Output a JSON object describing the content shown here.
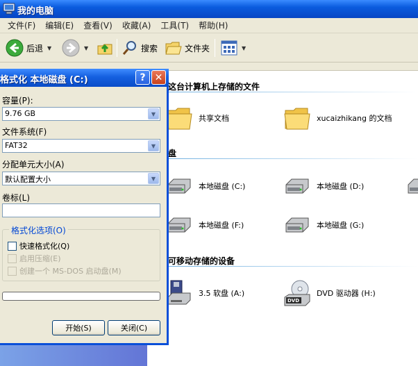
{
  "window": {
    "title": "我的电脑"
  },
  "menu": [
    "文件(F)",
    "编辑(E)",
    "查看(V)",
    "收藏(A)",
    "工具(T)",
    "帮助(H)"
  ],
  "toolbar": {
    "back": "后退",
    "search": "搜索",
    "folders": "文件夹"
  },
  "content": {
    "group1": "这台计算机上存储的文件",
    "shared_docs": "共享文档",
    "user_docs": "xucaizhikang 的文档",
    "group2": "盘",
    "drive_c": "本地磁盘 (C:)",
    "drive_d": "本地磁盘 (D:)",
    "drive_f": "本地磁盘 (F:)",
    "drive_g": "本地磁盘 (G:)",
    "group3": "可移动存储的设备",
    "floppy": "3.5 软盘 (A:)",
    "dvd": "DVD 驱动器 (H:)"
  },
  "dialog": {
    "title": "格式化 本地磁盘 (C:)",
    "capacity_label": "容量(P):",
    "capacity_value": "9.76 GB",
    "fs_label": "文件系统(F)",
    "fs_value": "FAT32",
    "alloc_label": "分配单元大小(A)",
    "alloc_value": "默认配置大小",
    "volume_label": "卷标(L)",
    "volume_value": "",
    "options_legend": "格式化选项(O)",
    "quick_format": "快速格式化(Q)",
    "compression": "启用压缩(E)",
    "msdos": "创建一个 MS-DOS 启动盘(M)",
    "start": "开始(S)",
    "close": "关闭(C)",
    "progress": 0
  },
  "colors": {
    "accent": "#0a4fd8",
    "legend": "#0046d5"
  }
}
